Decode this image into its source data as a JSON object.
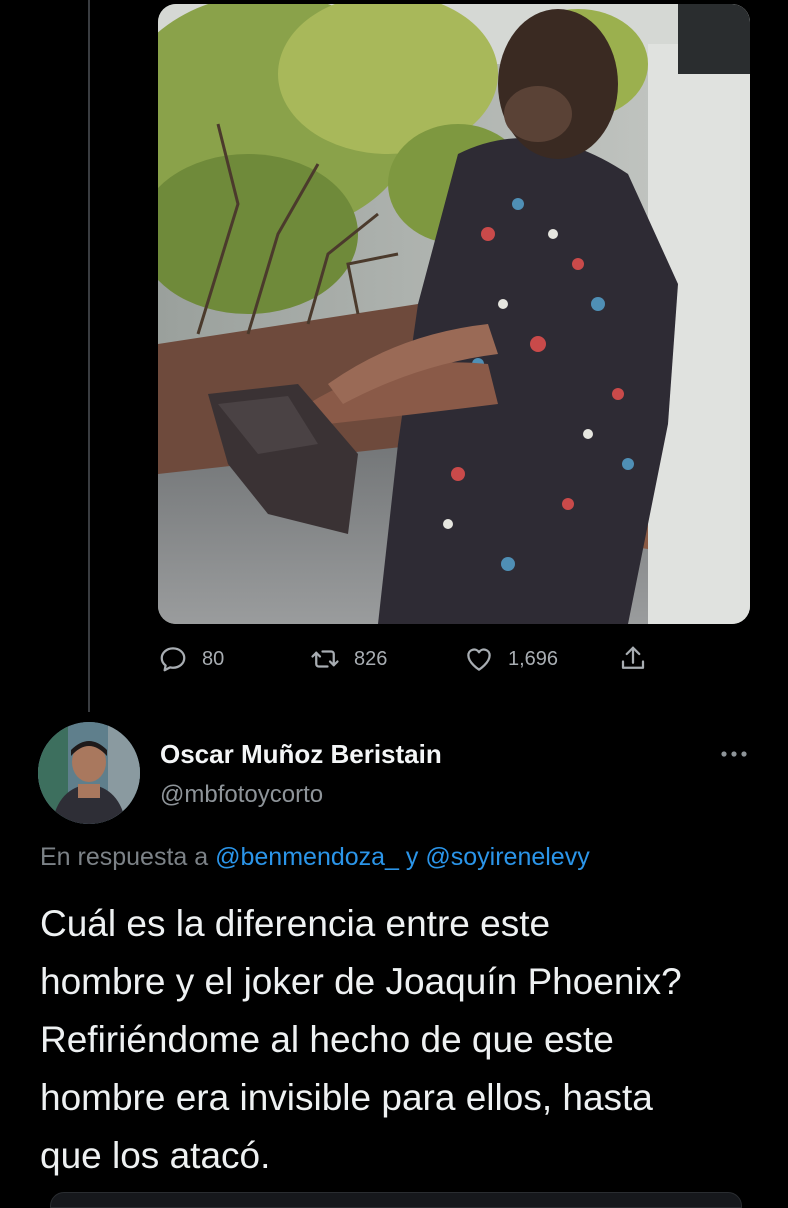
{
  "tweet_actions": {
    "replies": "80",
    "retweets": "826",
    "likes": "1,696"
  },
  "reply_tweet": {
    "display_name": "Oscar Muñoz Beristain",
    "handle": "@mbfotoycorto",
    "reply_prefix": "En respuesta a",
    "mention_1": "@benmendoza_",
    "connector": "y",
    "mention_2": "@soyirenelevy",
    "text_lines": [
      "Cuál es la diferencia entre este",
      "hombre y el joker de Joaquín Phoenix?",
      "Refiriéndome al hecho de que este",
      "hombre era invisible para ellos, hasta",
      "que los atacó."
    ]
  },
  "icons": {
    "reply": "speech-bubble-icon",
    "retweet": "retweet-arrows-icon",
    "like": "heart-icon",
    "share": "share-upload-icon",
    "more": "more-dots-icon"
  },
  "colors": {
    "background": "#000000",
    "mention": "#2b95e9",
    "muted": "#8e9499",
    "text": "#eef1f2"
  }
}
